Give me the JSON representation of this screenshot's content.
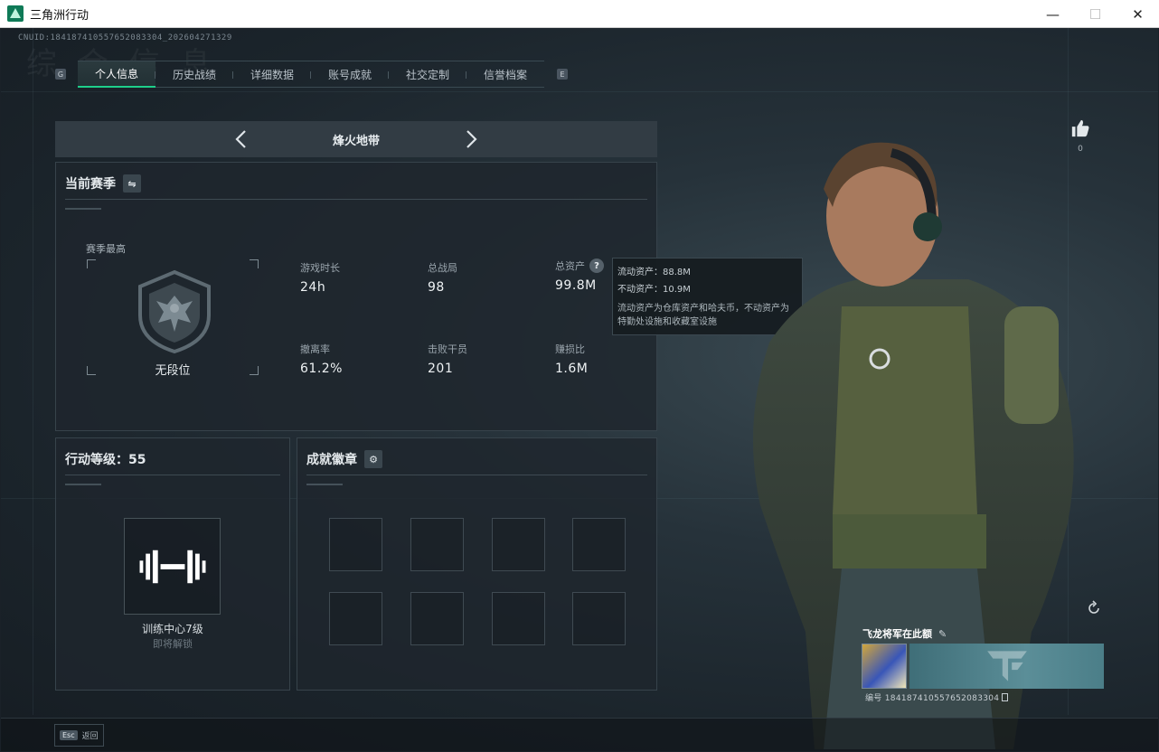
{
  "window": {
    "title": "三角洲行动",
    "minimize": "—",
    "maximize": "☐",
    "close": "✕"
  },
  "uid_text": "CNUID:184187410557652083304_202604271329",
  "bg_watermark": "综 合 信 息",
  "tabs": {
    "left_key": "G",
    "right_key": "E",
    "items": [
      {
        "label": "个人信息",
        "active": true
      },
      {
        "label": "历史战绩"
      },
      {
        "label": "详细数据"
      },
      {
        "label": "账号成就"
      },
      {
        "label": "社交定制"
      },
      {
        "label": "信誉档案"
      }
    ]
  },
  "mode": {
    "title": "烽火地带"
  },
  "season": {
    "title": "当前赛季",
    "peak_label": "赛季最高",
    "rank_name": "无段位",
    "stats": [
      {
        "label": "游戏时长",
        "value": "24h"
      },
      {
        "label": "总战局",
        "value": "98"
      },
      {
        "label": "总资产",
        "value": "99.8M",
        "help": "?"
      },
      {
        "label": "撤离率",
        "value": "61.2%"
      },
      {
        "label": "击败干员",
        "value": "201"
      },
      {
        "label": "赚损比",
        "value": "1.6M"
      }
    ]
  },
  "tooltip": {
    "liquid": "流动资产：88.8M",
    "fixed": "不动资产：10.9M",
    "description": "流动资产为仓库资产和哈夫币，不动资产为特勤处设施和收藏室设施"
  },
  "level": {
    "title": "行动等级：55",
    "facility_name": "训练中心7级",
    "facility_status": "即将解锁"
  },
  "badges": {
    "title": "成就徽章",
    "slots": 8
  },
  "profile": {
    "like_count": "0",
    "player_name": "飞龙将军在此额",
    "player_id": "编号 184187410557652083304"
  },
  "footer": {
    "esc_key": "Esc",
    "esc_label": "返回"
  },
  "colors": {
    "accent": "#1ecf8a",
    "panel_border": "#37434b"
  }
}
